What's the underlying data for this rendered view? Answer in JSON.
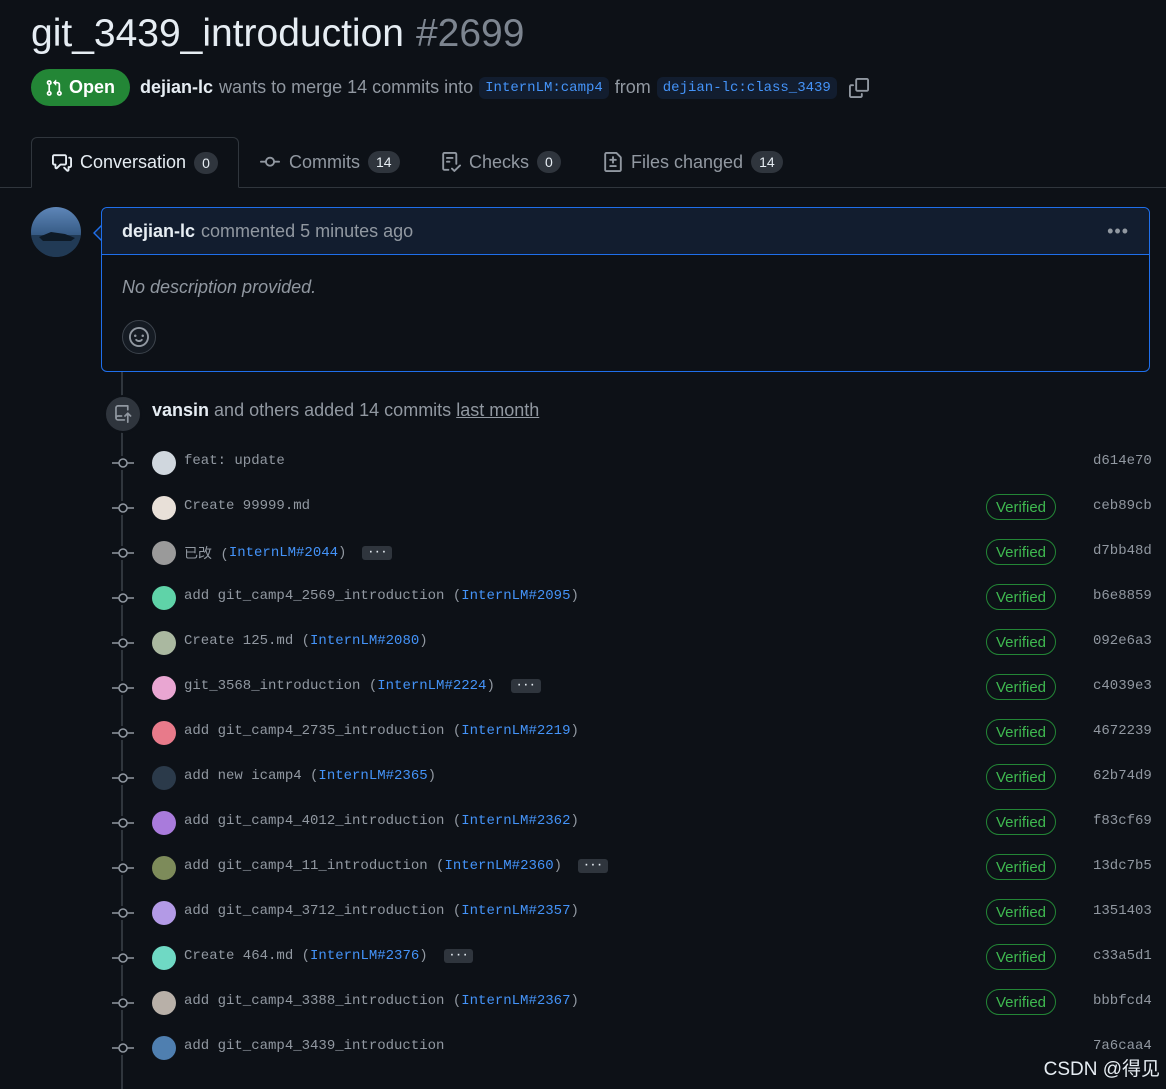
{
  "pr": {
    "title": "git_3439_introduction",
    "number": "#2699",
    "state": "Open",
    "author": "dejian-lc",
    "merge_text": "wants to merge 14 commits into",
    "base_branch": "InternLM:camp4",
    "from_text": "from",
    "head_branch": "dejian-lc:class_3439"
  },
  "tabs": [
    {
      "label": "Conversation",
      "count": "0",
      "icon": "comment-discussion-icon"
    },
    {
      "label": "Commits",
      "count": "14",
      "icon": "git-commit-icon"
    },
    {
      "label": "Checks",
      "count": "0",
      "icon": "checklist-icon"
    },
    {
      "label": "Files changed",
      "count": "14",
      "icon": "file-diff-icon"
    }
  ],
  "comment": {
    "author": "dejian-lc",
    "action": "commented 5 minutes ago",
    "body": "No description provided."
  },
  "commits_event": {
    "author": "vansin",
    "text": "and others added 14 commits",
    "when": "last month"
  },
  "commits": [
    {
      "message": "feat: update",
      "ref": "",
      "verified": "",
      "sha": "d614e70"
    },
    {
      "message": "Create 99999.md",
      "ref": "",
      "verified": "Verified",
      "sha": "ceb89cb"
    },
    {
      "message": "已改 (",
      "ref": "InternLM#2044",
      "verified": "Verified",
      "sha": "d7bb48d",
      "ellipsis": "···"
    },
    {
      "message": "add git_camp4_2569_introduction (",
      "ref": "InternLM#2095",
      "verified": "Verified",
      "sha": "b6e8859"
    },
    {
      "message": "Create 125.md (",
      "ref": "InternLM#2080",
      "verified": "Verified",
      "sha": "092e6a3"
    },
    {
      "message": "git_3568_introduction (",
      "ref": "InternLM#2224",
      "verified": "Verified",
      "sha": "c4039e3",
      "ellipsis": "···"
    },
    {
      "message": "add git_camp4_2735_introduction (",
      "ref": "InternLM#2219",
      "verified": "Verified",
      "sha": "4672239"
    },
    {
      "message": "add new icamp4 (",
      "ref": "InternLM#2365",
      "verified": "Verified",
      "sha": "62b74d9"
    },
    {
      "message": "add git_camp4_4012_introduction (",
      "ref": "InternLM#2362",
      "verified": "Verified",
      "sha": "f83cf69"
    },
    {
      "message": "add git_camp4_11_introduction (",
      "ref": "InternLM#2360",
      "verified": "Verified",
      "sha": "13dc7b5",
      "ellipsis": "···"
    },
    {
      "message": "add git_camp4_3712_introduction (",
      "ref": "InternLM#2357",
      "verified": "Verified",
      "sha": "1351403"
    },
    {
      "message": "Create 464.md (",
      "ref": "InternLM#2376",
      "verified": "Verified",
      "sha": "c33a5d1",
      "ellipsis": "···"
    },
    {
      "message": "add git_camp4_3388_introduction (",
      "ref": "InternLM#2367",
      "verified": "Verified",
      "sha": "bbbfcd4"
    },
    {
      "message": "add git_camp4_3439_introduction",
      "ref": "",
      "verified": "",
      "sha": "7a6caa4"
    }
  ],
  "watermark": "CSDN @得见",
  "colors": {
    "background": "#0d1117",
    "open_badge": "#238636",
    "link": "#4493f8",
    "verified": "#3fb950",
    "border_active": "#1f6feb"
  }
}
